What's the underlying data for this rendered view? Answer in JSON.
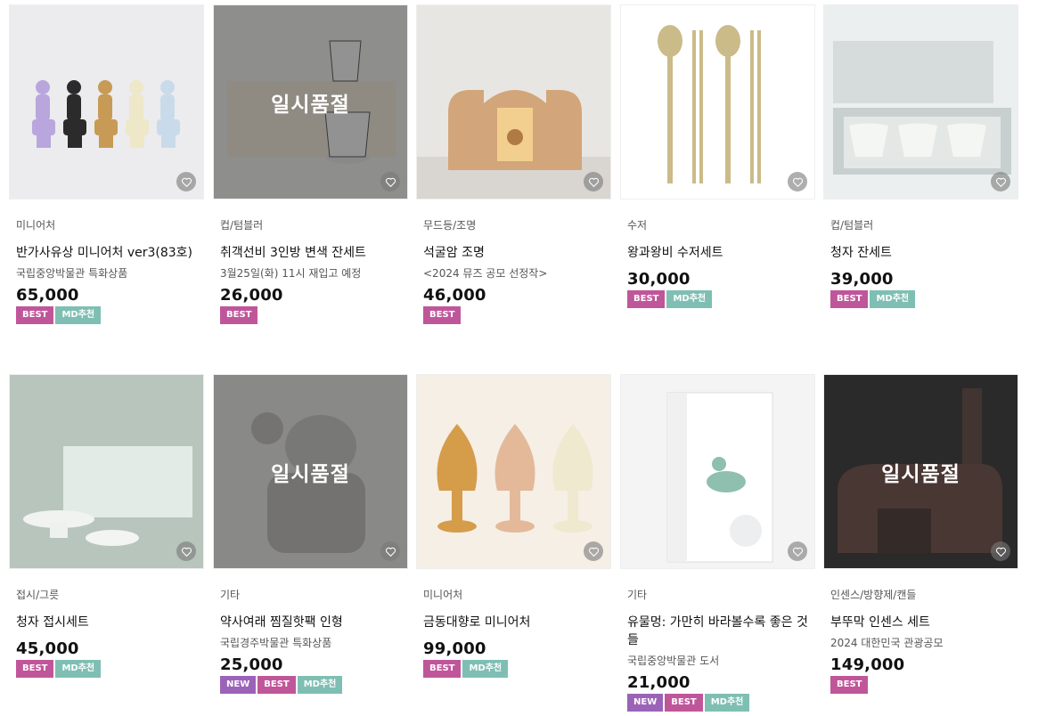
{
  "overlay_text": "일시품절",
  "badge_labels": {
    "best": "BEST",
    "md": "MD추천",
    "new": "NEW"
  },
  "colors": {
    "best": "#c0569a",
    "md": "#7fbfb3",
    "new": "#9b63b8"
  },
  "products": [
    {
      "category": "미니어처",
      "name": "반가사유상 미니어처 ver3(83호)",
      "sub": "국립중앙박물관 특화상품",
      "price": "65,000",
      "badges": [
        "best",
        "md"
      ],
      "soldout": false,
      "icon": "pensive-bodhisattva-figurines-image"
    },
    {
      "category": "컵/텀블러",
      "name": "취객선비 3인방 변색 잔세트",
      "sub": "3월25일(화) 11시 재입고 예정",
      "price": "26,000",
      "badges": [
        "best"
      ],
      "soldout": true,
      "icon": "cup-set-image"
    },
    {
      "category": "무드등/조명",
      "name": "석굴암 조명",
      "sub": "<2024 뮤즈 공모 선정작>",
      "price": "46,000",
      "badges": [
        "best"
      ],
      "soldout": false,
      "icon": "seokguram-lamp-image"
    },
    {
      "category": "수저",
      "name": "왕과왕비 수저세트",
      "sub": "",
      "price": "30,000",
      "badges": [
        "best",
        "md"
      ],
      "soldout": false,
      "icon": "spoon-chopsticks-image"
    },
    {
      "category": "컵/텀블러",
      "name": "청자 잔세트",
      "sub": "",
      "price": "39,000",
      "badges": [
        "best",
        "md"
      ],
      "soldout": false,
      "icon": "celadon-cup-set-image"
    },
    {
      "category": "접시/그릇",
      "name": "청자 접시세트",
      "sub": "",
      "price": "45,000",
      "badges": [
        "best",
        "md"
      ],
      "soldout": false,
      "icon": "celadon-plate-set-image"
    },
    {
      "category": "기타",
      "name": "약사여래 찜질핫팩 인형",
      "sub": "국립경주박물관 특화상품",
      "price": "25,000",
      "badges": [
        "new",
        "best",
        "md"
      ],
      "soldout": true,
      "icon": "hot-pack-doll-image"
    },
    {
      "category": "미니어처",
      "name": "금동대향로 미니어처",
      "sub": "",
      "price": "99,000",
      "badges": [
        "best",
        "md"
      ],
      "soldout": false,
      "icon": "incense-burner-miniature-image"
    },
    {
      "category": "기타",
      "name": "유물멍: 가만히 바라볼수록 좋은 것들",
      "sub": "국립중앙박물관 도서",
      "price": "21,000",
      "badges": [
        "new",
        "best",
        "md"
      ],
      "soldout": false,
      "icon": "book-image"
    },
    {
      "category": "인센스/방향제/캔들",
      "name": "부뚜막 인센스 세트",
      "sub": "2024 대한민국 관광공모",
      "price": "149,000",
      "badges": [
        "best"
      ],
      "soldout": true,
      "icon": "incense-set-image"
    }
  ]
}
